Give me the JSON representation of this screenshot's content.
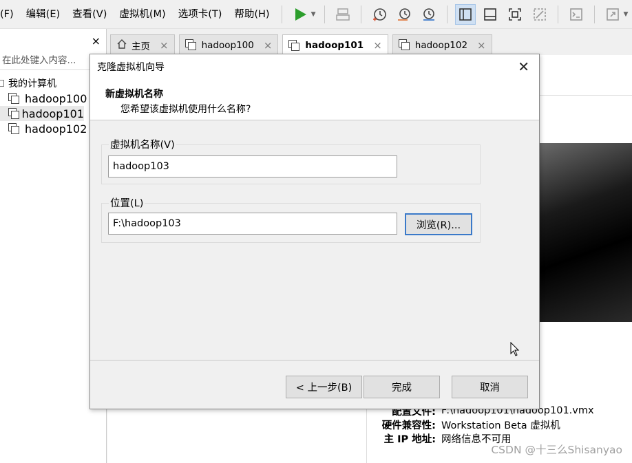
{
  "menubar": {
    "items": [
      "(F)",
      "编辑(E)",
      "查看(V)",
      "虚拟机(M)",
      "选项卡(T)",
      "帮助(H)"
    ]
  },
  "toolbar": {
    "icons": [
      "play-icon",
      "send-keys-icon",
      "snapshot-icon",
      "revert-snapshot-icon",
      "snapshot-manager-icon",
      "sidebar-view-icon",
      "console-view-icon",
      "fit-guest-icon",
      "unity-icon",
      "terminal-icon",
      "fullscreen-icon"
    ],
    "accent": "#2c9e2c"
  },
  "library": {
    "close": "×",
    "search_placeholder": "在此处键入内容...",
    "root_label": "我的计算机",
    "items": [
      "hadoop100",
      "hadoop101",
      "hadoop102"
    ],
    "selected": "hadoop101"
  },
  "tabs": [
    {
      "label": "主页",
      "icon": "home-icon"
    },
    {
      "label": "hadoop100",
      "icon": "vm-icon"
    },
    {
      "label": "hadoop101",
      "icon": "vm-icon",
      "active": true
    },
    {
      "label": "hadoop102",
      "icon": "vm-icon"
    }
  ],
  "tab_close": "×",
  "details": {
    "rows": [
      {
        "label": "配置文件:",
        "value": "F:\\hadoop101\\hadoop101.vmx"
      },
      {
        "label": "硬件兼容性:",
        "value": "Workstation Beta 虚拟机"
      },
      {
        "label": "主 IP 地址:",
        "value": "网络信息不可用"
      }
    ]
  },
  "watermark": "CSDN @十三么Shisanyao",
  "dialog": {
    "title": "克隆虚拟机向导",
    "close": "✕",
    "heading": "新虚拟机名称",
    "subheading": "您希望该虚拟机使用什么名称?",
    "name_label": "虚拟机名称(V)",
    "name_value": "hadoop103",
    "location_label": "位置(L)",
    "location_value": "F:\\hadoop103",
    "browse_label": "浏览(R)...",
    "back_label": "< 上一步(B)",
    "finish_label": "完成",
    "cancel_label": "取消"
  }
}
